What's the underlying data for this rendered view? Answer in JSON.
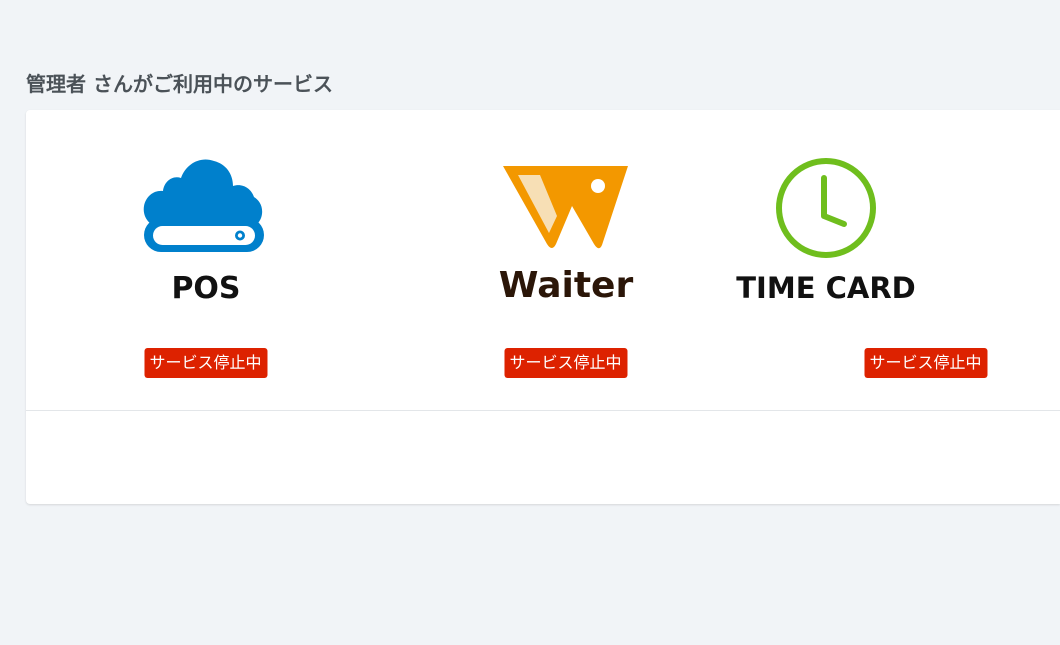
{
  "page": {
    "title": "管理者 さんがご利用中のサービス"
  },
  "services": [
    {
      "name": "POS",
      "icon": "cloud-drive-icon",
      "status": "サービス停止中"
    },
    {
      "name": "Waiter",
      "icon": "waiter-w-icon",
      "status": "サービス停止中"
    },
    {
      "name": "TIME CARD",
      "icon": "clock-icon",
      "status": "サービス停止中"
    }
  ],
  "colors": {
    "background": "#f1f4f7",
    "title": "#4b5258",
    "badge": "#dd2200",
    "pos_blue": "#0080cc",
    "waiter_orange": "#f39800",
    "waiter_brown": "#2b1608",
    "timecard_green": "#6fbe1d"
  }
}
